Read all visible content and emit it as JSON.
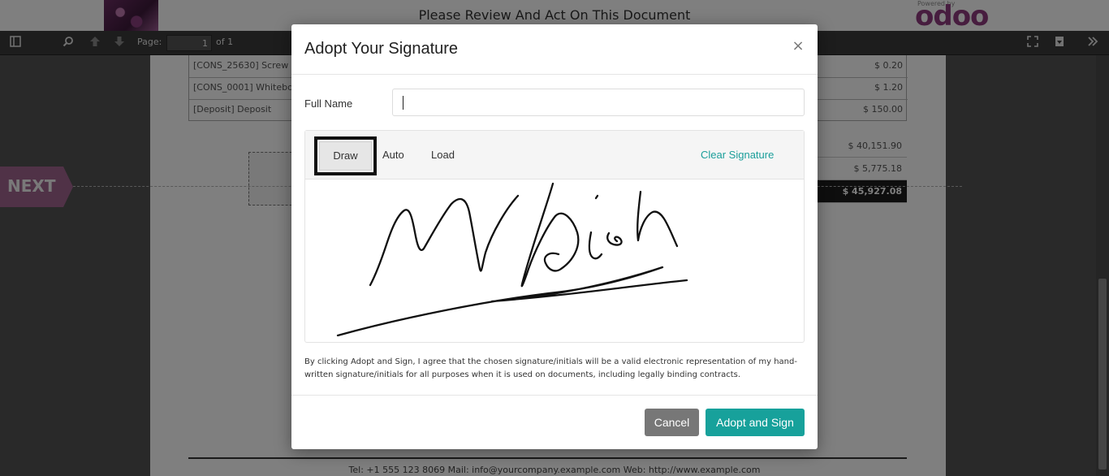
{
  "header": {
    "title": "Please Review And Act On This Document",
    "logo_powered": "Powered by",
    "logo_word": "odoo",
    "brand_color": "#8f3b7e"
  },
  "pdf_toolbar": {
    "page_label": "Page:",
    "page_number": "1",
    "page_total": "of 1",
    "icons": [
      "sidebar-toggle-icon",
      "search-icon",
      "arrow-up-icon",
      "arrow-down-icon",
      "fullscreen-icon",
      "download-icon",
      "tools-icon"
    ]
  },
  "document": {
    "lines": [
      {
        "desc": "[CONS_25630] Screw",
        "amount": "$ 0.20"
      },
      {
        "desc": "[CONS_0001] Whitebo",
        "amount": "$ 1.20"
      },
      {
        "desc": "[Deposit] Deposit",
        "amount": "$ 150.00"
      }
    ],
    "totals": [
      {
        "value": "$ 40,151.90"
      },
      {
        "value": "$ 5,775.18"
      },
      {
        "value": "$ 45,927.08"
      }
    ],
    "next_label": "NEXT",
    "footer": "Tel: +1 555 123 8069    Mail: info@yourcompany.example.com    Web: http://www.example.com"
  },
  "modal": {
    "title": "Adopt Your Signature",
    "close_icon": "×",
    "full_name_label": "Full Name",
    "full_name_value": "",
    "tabs": {
      "draw": "Draw",
      "auto": "Auto",
      "load": "Load",
      "active": "draw"
    },
    "clear_label": "Clear Signature",
    "legal_text": "By clicking Adopt and Sign, I agree that the chosen signature/initials will be a valid electronic representation of my hand-written signature/initials for all purposes when it is used on documents, including legally binding contracts.",
    "cancel_label": "Cancel",
    "adopt_label": "Adopt and Sign",
    "accent_color": "#17a19b"
  }
}
